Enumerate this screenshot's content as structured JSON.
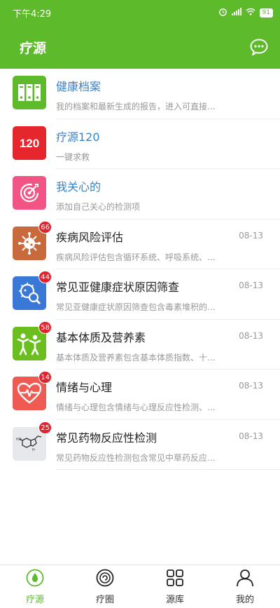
{
  "status_bar": {
    "time": "下午4:29",
    "battery": "91"
  },
  "header": {
    "title": "疗源"
  },
  "list": [
    {
      "title": "健康档案",
      "subtitle": "我的档案和最新生成的报告，进入可直接...",
      "date": "",
      "badge": "",
      "icon": "archive-icon",
      "color": "#5cba2b"
    },
    {
      "title": "疗源120",
      "subtitle": "一键求救",
      "date": "",
      "badge": "",
      "icon": "emergency-120-icon",
      "color": "#e5262d"
    },
    {
      "title": "我关心的",
      "subtitle": "添加自己关心的检测项",
      "date": "",
      "badge": "",
      "icon": "target-icon",
      "color": "#f25585"
    },
    {
      "title": "疾病风险评估",
      "subtitle": "疾病风险评估包含循环系统、呼吸系统、...",
      "date": "08-13",
      "badge": "66",
      "icon": "virus-icon",
      "color": "#c86a3b"
    },
    {
      "title": "常见亚健康症状原因筛查",
      "subtitle": "常见亚健康症状原因筛查包含毒素堆积的...",
      "date": "08-13",
      "badge": "44",
      "icon": "cell-magnifier-icon",
      "color": "#3a78d8"
    },
    {
      "title": "基本体质及营养素",
      "subtitle": "基本体质及营养素包含基本体质指数、十...",
      "date": "08-13",
      "badge": "58",
      "icon": "family-icon",
      "color": "#6abf1e"
    },
    {
      "title": "情绪与心理",
      "subtitle": "情绪与心理包含情绪与心理反应性检测、...",
      "date": "08-13",
      "badge": "14",
      "icon": "heartbeat-icon",
      "color": "#ef5a52"
    },
    {
      "title": "常见药物反应性检测",
      "subtitle": "常见药物反应性检测包含常见中草药反应...",
      "date": "08-13",
      "badge": "25",
      "icon": "molecule-icon",
      "color": "#e6e8ec"
    }
  ],
  "tabs": [
    {
      "label": "疗源",
      "icon": "drop-icon",
      "active": true
    },
    {
      "label": "疗圈",
      "icon": "circle-icon",
      "active": false
    },
    {
      "label": "源库",
      "icon": "grid-icon",
      "active": false
    },
    {
      "label": "我的",
      "icon": "person-icon",
      "active": false
    }
  ],
  "colors": {
    "brand": "#5cba2b",
    "link_blue": "#3a82c7",
    "badge_red": "#e0242f"
  }
}
